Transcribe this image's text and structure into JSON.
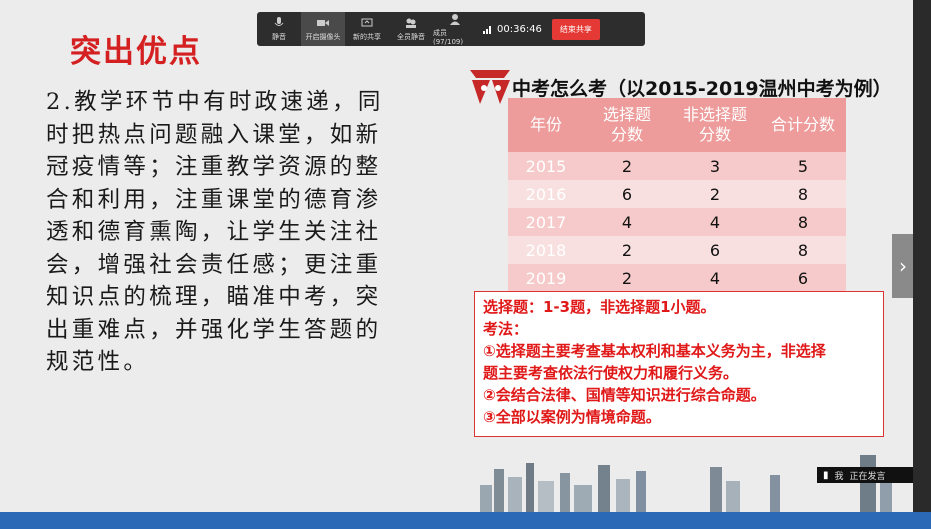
{
  "slide": {
    "title": "突出优点",
    "body_lines": [
      "2.教学环节中有时政速递，同",
      "时把热点问题融入课堂，如新",
      "冠疫情等；注重教学资源的整",
      "合和利用，注重课堂的德育渗",
      "透和德育熏陶，让学生关注社",
      "会，增强社会责任感；更注重",
      "知识点的梳理，瞄准中考，突",
      "出重难点，并强化学生答题的",
      "规范性。"
    ]
  },
  "figure": {
    "title": "中考怎么考（以2015-2019温州中考为例）",
    "table": {
      "headers": [
        "年份",
        "选择题\n分数",
        "非选择题\n分数",
        "合计分数"
      ],
      "rows": [
        [
          "2015",
          "2",
          "3",
          "5"
        ],
        [
          "2016",
          "6",
          "2",
          "8"
        ],
        [
          "2017",
          "4",
          "4",
          "8"
        ],
        [
          "2018",
          "2",
          "6",
          "8"
        ],
        [
          "2019",
          "2",
          "4",
          "6"
        ]
      ]
    },
    "notes": [
      "选择题：1-3题，非选择题1小题。",
      "考法：",
      "①选择题主要考查基本权利和基本义务为主，非选择",
      "题主要考查依法行使权力和履行义务。",
      "②会结合法律、国情等知识进行综合命题。",
      "③全部以案例为情境命题。"
    ]
  },
  "toolbar": {
    "buttons": [
      {
        "label": "静音",
        "icon": "mic-icon"
      },
      {
        "label": "开启摄像头",
        "icon": "camera-icon"
      },
      {
        "label": "新的共享",
        "icon": "share-icon"
      },
      {
        "label": "全员静音",
        "icon": "mute-all-icon"
      },
      {
        "label": "成员(97/109)",
        "icon": "participants-icon"
      }
    ],
    "timer": "00:36:46",
    "end_share": "结束共享"
  },
  "speaking": {
    "name": "我",
    "status": "正在发言"
  },
  "colors": {
    "title_red": "#d42020",
    "header_pink": "#ee9b9b",
    "end_button": "#e53935"
  }
}
